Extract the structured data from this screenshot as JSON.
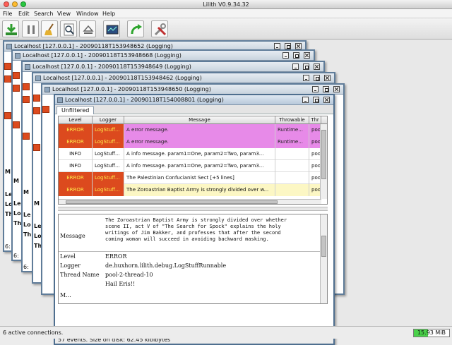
{
  "app": {
    "title": "Lilith V0.9.34.32"
  },
  "menu": [
    "File",
    "Edit",
    "Search",
    "View",
    "Window",
    "Help"
  ],
  "toolbar": {
    "buttons": [
      {
        "icon": "import-download-icon"
      },
      {
        "icon": "pause-icon"
      },
      {
        "icon": "broom-clean-icon"
      },
      {
        "icon": "find-preview-icon"
      },
      {
        "icon": "eject-icon"
      },
      {
        "icon": "statistics-monitor-icon"
      },
      {
        "icon": "redo-arrow-icon"
      },
      {
        "icon": "tools-preferences-icon"
      }
    ]
  },
  "background_windows": [
    {
      "title": "Localhost [127.0.0.1] - 20090118T153948652 (Logging)"
    },
    {
      "title": "Localhost [127.0.0.1] - 20090118T153948668 (Logging)"
    },
    {
      "title": "Localhost [127.0.0.1] - 20090118T153948649 (Logging)"
    },
    {
      "title": "Localhost [127.0.0.1] - 20090118T153948462 (Logging)"
    },
    {
      "title": "Localhost [127.0.0.1] - 20090118T153948650 (Logging)"
    }
  ],
  "bg_fragments": {
    "m": "M",
    "le": "Le",
    "lo": "Lo",
    "th": "Th",
    "six": "6:"
  },
  "front_window": {
    "title": "Localhost [127.0.0.1] - 20090118T154008801 (Logging)",
    "tab": "Unfiltered",
    "columns": [
      "Level",
      "Logger",
      "Message",
      "Throwable",
      "Thr"
    ],
    "rows": [
      {
        "level": "ERROR",
        "logger": "LogStuff...",
        "message": "A error message.",
        "throwable": "Runtime...",
        "thread": "pool"
      },
      {
        "level": "ERROR",
        "logger": "LogStuff...",
        "message": "A error message.",
        "throwable": "Runtime...",
        "thread": "pool"
      },
      {
        "level": "INFO",
        "logger": "LogStuff...",
        "message": "A info message. param1=One, param2=Two, param3...",
        "throwable": "",
        "thread": "pool"
      },
      {
        "level": "INFO",
        "logger": "LogStuff...",
        "message": "A info message. param1=One, param2=Two, param3...",
        "throwable": "",
        "thread": "pool"
      },
      {
        "level": "ERROR",
        "logger": "LogStuff...",
        "message": "The Palestinian Confucianist Sect [+5 lines]",
        "throwable": "",
        "thread": "pool"
      },
      {
        "level": "ERROR",
        "logger": "LogStuff...",
        "message": "The Zoroastrian Baptist Army is strongly divided over w...",
        "throwable": "",
        "thread": "pool"
      }
    ],
    "detail": {
      "message_label": "Message",
      "message_lines": [
        "The Zoroastrian Baptist Army is strongly divided over whether",
        "scene II, act V of \"The Search for Spock\" explains the holy",
        "writings of Jim Bakker, and professes that after the second",
        "coming woman will succeed in avoiding backward masking."
      ],
      "level_label": "Level",
      "level_value": "ERROR",
      "logger_label": "Logger",
      "logger_value": "de.huxhorn.lilith.debug.LogStuffRunnable",
      "thread_label": "Thread Name",
      "thread_value": "pool-2-thread-10",
      "extra_value": "Hail Eris!!",
      "cut_label": "M..."
    },
    "status": "57 events.   Size on disk: 62.45 kibibytes"
  },
  "status": {
    "connections": "6 active connections.",
    "memory": "15.93 MiB",
    "memory_fraction": 0.4
  },
  "colors": {
    "error_bg": "#dc4a1e",
    "error_text": "#ffe94a",
    "msg_highlight": "#e78ae8",
    "selection_border": "#2ec82e",
    "yellow_row": "#fcf7c4",
    "frame_border": "#5f7c99"
  }
}
